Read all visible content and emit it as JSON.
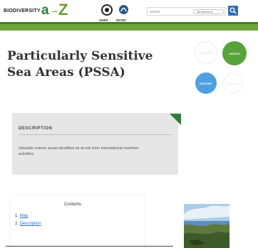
{
  "header": {
    "logo_text": "BIODIVERSITY",
    "logo_a": "a",
    "logo_dash": "–",
    "logo_z": "Z",
    "partner_un_label": "UNEP",
    "partner_wcmc_label": "WCMC",
    "search": {
      "placeholder": "Search",
      "value": ""
    },
    "theme_select": {
      "selected": "All themes ▾"
    }
  },
  "page": {
    "title": "Particularly Sensitive Sea Areas (PSSA)"
  },
  "nav_circles": [
    {
      "label": "Species",
      "active": false,
      "color": "#ffffff"
    },
    {
      "label": "Areas",
      "active": true,
      "color": "#57a33a"
    },
    {
      "label": "Marine",
      "active": true,
      "color": "#4fa0e0"
    },
    {
      "label": "Tools",
      "active": false,
      "color": "#ffffff"
    }
  ],
  "description": {
    "heading": "DESCRIPTION",
    "text": "Valuable marine areas identified as at risk from international maritime activities."
  },
  "contents": {
    "title": "Contents",
    "items": [
      {
        "number": "1.",
        "label": "Map"
      },
      {
        "number": "2.",
        "label": "Description"
      }
    ]
  },
  "colors": {
    "brand_green": "#6ca53a",
    "dark_green": "#2f7d3a",
    "search_blue": "#2f6fb7",
    "link_blue": "#2a6fcc"
  }
}
